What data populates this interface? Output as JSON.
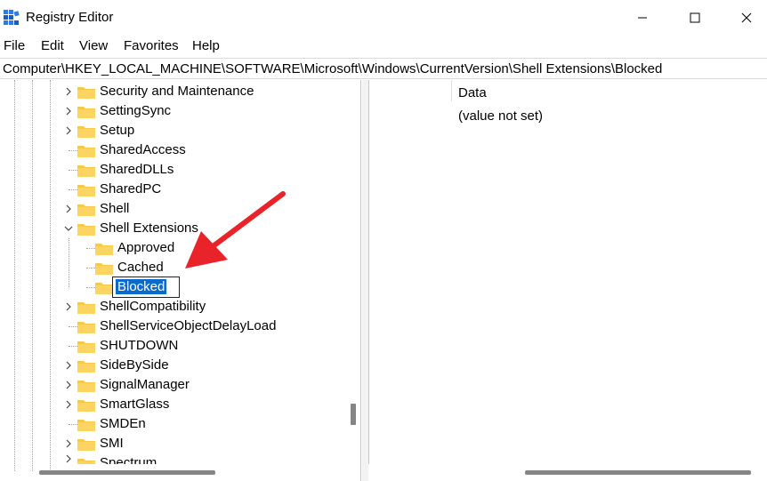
{
  "window": {
    "title": "Registry Editor",
    "minimize_glyph": "—",
    "maximize_glyph": "☐",
    "close_glyph": "✕"
  },
  "menu": [
    "File",
    "Edit",
    "View",
    "Favorites",
    "Help"
  ],
  "address": {
    "path": "Computer\\HKEY_LOCAL_MACHINE\\SOFTWARE\\Microsoft\\Windows\\CurrentVersion\\Shell Extensions\\Blocked"
  },
  "tree": {
    "items": [
      {
        "label": "Security and Maintenance",
        "expandable": true,
        "level": 0
      },
      {
        "label": "SettingSync",
        "expandable": true,
        "level": 0
      },
      {
        "label": "Setup",
        "expandable": true,
        "level": 0
      },
      {
        "label": "SharedAccess",
        "expandable": false,
        "level": 0
      },
      {
        "label": "SharedDLLs",
        "expandable": false,
        "level": 0
      },
      {
        "label": "SharedPC",
        "expandable": false,
        "level": 0
      },
      {
        "label": "Shell",
        "expandable": true,
        "level": 0
      },
      {
        "label": "Shell Extensions",
        "expandable": true,
        "expanded": true,
        "level": 0
      },
      {
        "label": "Approved",
        "expandable": false,
        "level": 1
      },
      {
        "label": "Cached",
        "expandable": false,
        "level": 1
      },
      {
        "label": "Blocked",
        "expandable": false,
        "level": 1,
        "selected": true,
        "editing": true
      },
      {
        "label": "ShellCompatibility",
        "expandable": true,
        "level": 0
      },
      {
        "label": "ShellServiceObjectDelayLoad",
        "expandable": false,
        "level": 0
      },
      {
        "label": "SHUTDOWN",
        "expandable": false,
        "level": 0
      },
      {
        "label": "SideBySide",
        "expandable": true,
        "level": 0
      },
      {
        "label": "SignalManager",
        "expandable": true,
        "level": 0
      },
      {
        "label": "SmartGlass",
        "expandable": true,
        "level": 0
      },
      {
        "label": "SMDEn",
        "expandable": false,
        "level": 0
      },
      {
        "label": "SMI",
        "expandable": true,
        "level": 0
      },
      {
        "label": "Spectrum",
        "expandable": true,
        "level": 0
      }
    ]
  },
  "values_pane": {
    "column_header": "Data",
    "rows": [
      {
        "data": "(value not set)"
      }
    ]
  },
  "colors": {
    "selection": "#0a6bc9",
    "folder": "#f8c948",
    "annotation_arrow": "#e8232a"
  }
}
